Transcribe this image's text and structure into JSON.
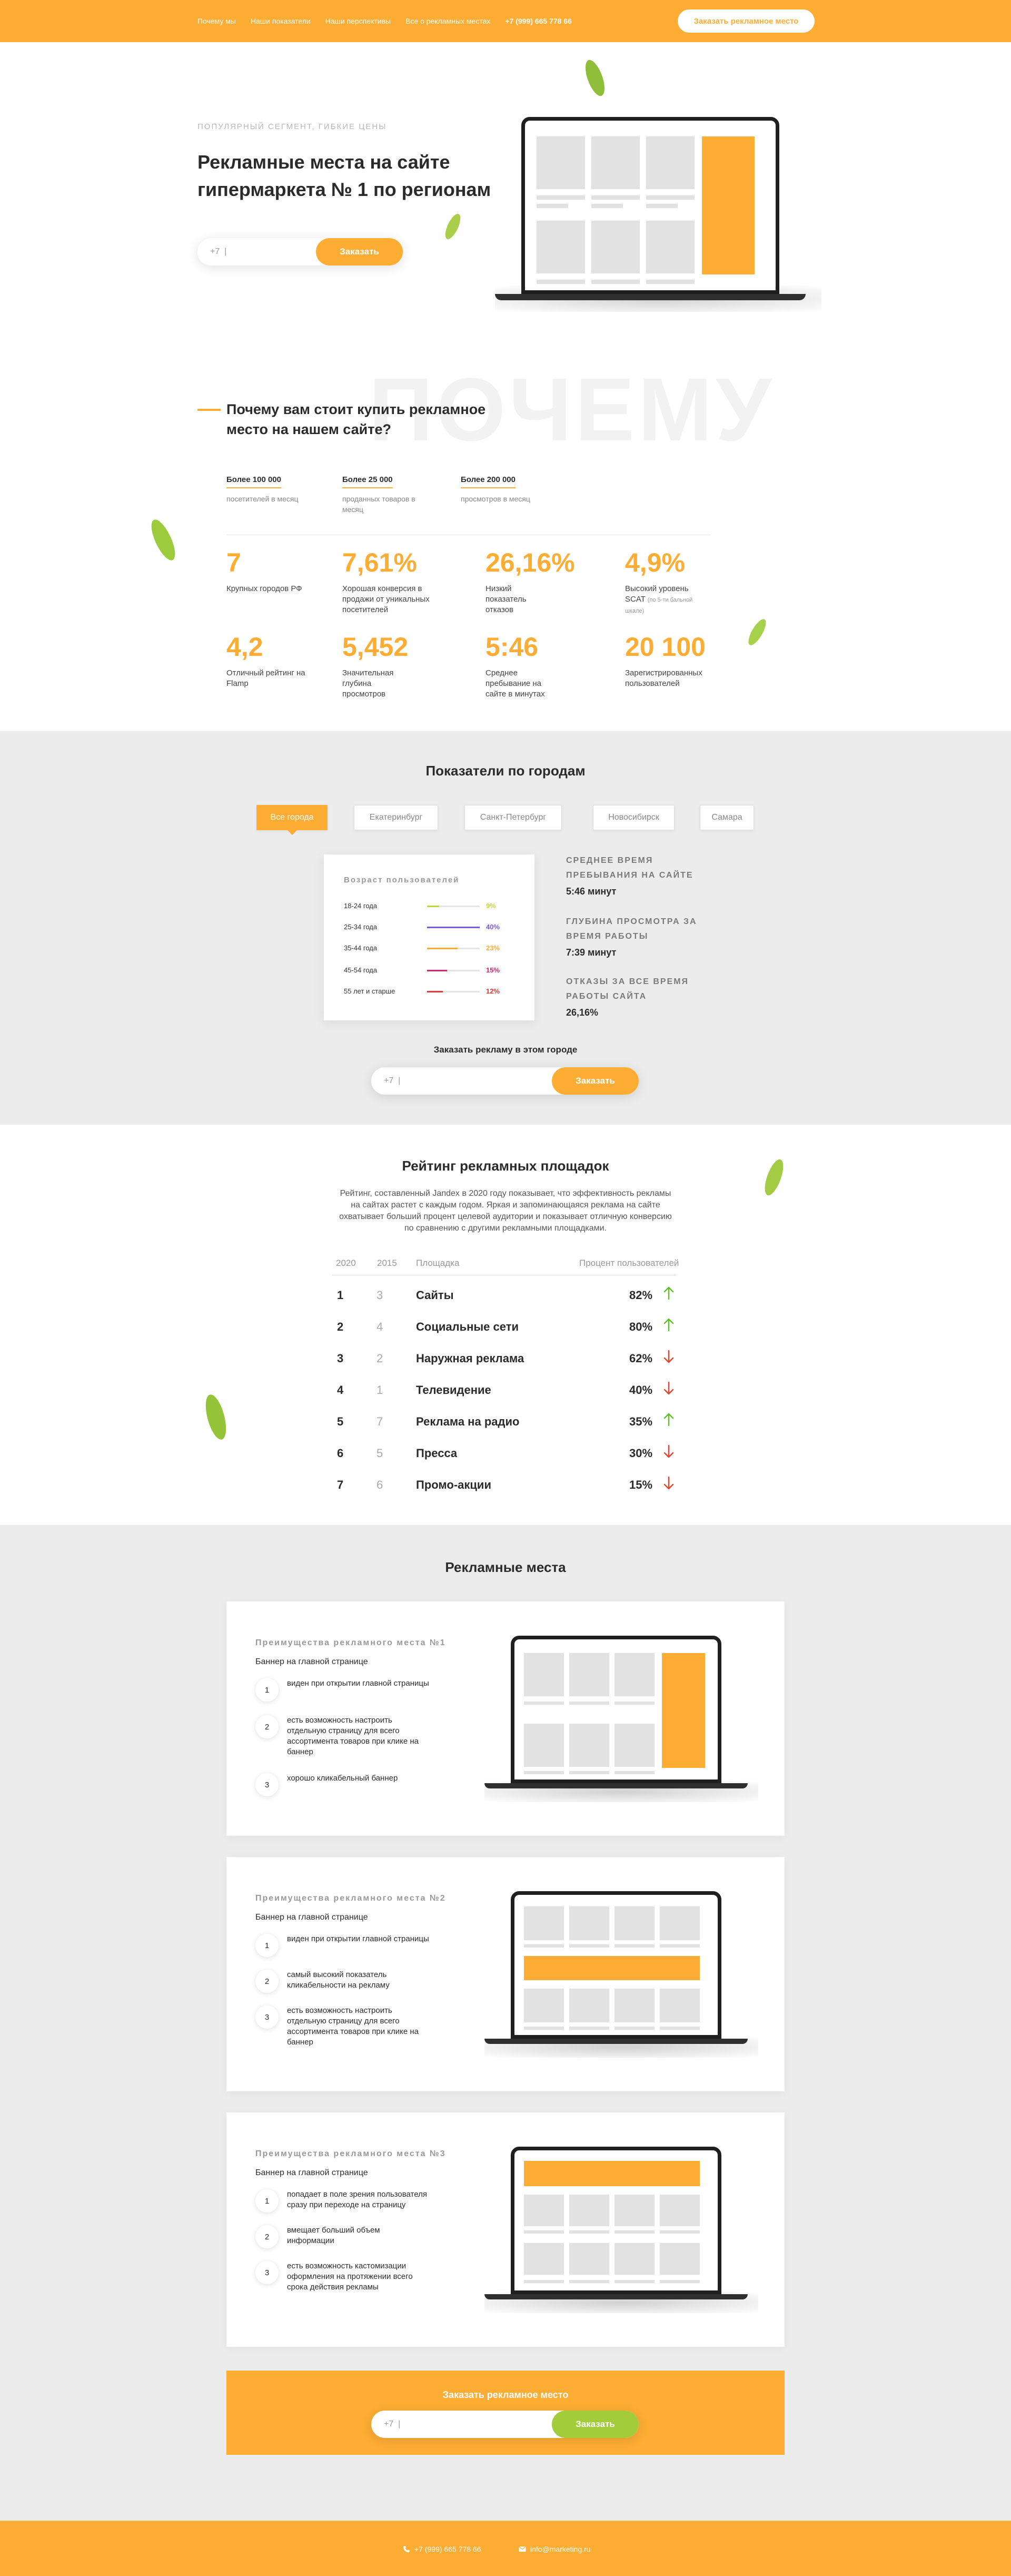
{
  "header": {
    "nav": [
      "Почему мы",
      "Наши показатели",
      "Наши перспективы",
      "Все о рекламных местах"
    ],
    "phone": "+7 (999) 665 778 66",
    "order_button": "Заказать рекламное место"
  },
  "hero": {
    "subtitle": "Популярный сегмент, гибкие цены",
    "title": "Рекламные места на сайте гипермаркета № 1 по регионам",
    "phone_prefix": "+7",
    "order_button": "Заказать"
  },
  "why": {
    "watermark": "ПОЧЕМУ",
    "title": "Почему вам стоит купить рекламное место на нашем сайте?",
    "small_stats": [
      {
        "value": "Более 100 000",
        "label": "посетителей в месяц"
      },
      {
        "value": "Более 25 000",
        "label": "проданных товаров в месяц"
      },
      {
        "value": "Более 200 000",
        "label": "просмотров в месяц"
      }
    ],
    "big_stats": [
      {
        "value": "7",
        "label": "Крупных городов РФ"
      },
      {
        "value": "7,61%",
        "label": "Хорошая конверсия в продажи от уникальных посетителей"
      },
      {
        "value": "26,16%",
        "label": "Низкий показатель отказов"
      },
      {
        "value": "4,9%",
        "label": "Высокий уровень SCAT",
        "note": "(по 5-ти бальной шкале)"
      },
      {
        "value": "4,2",
        "label": "Отличный рейтинг на Flamp"
      },
      {
        "value": "5,452",
        "label": "Значительная глубина просмотров"
      },
      {
        "value": "5:46",
        "label": "Среднее пребывание на сайте в минутах"
      },
      {
        "value": "20 100",
        "label": "Зарегистрированных пользователей"
      }
    ]
  },
  "cities": {
    "title": "Показатели по городам",
    "tabs": [
      "Все города",
      "Екатеринбург",
      "Санкт-Петербург",
      "Новосибирск",
      "Самара"
    ],
    "active_tab": "Все города",
    "age_card_title": "Возраст пользователей",
    "ages": [
      {
        "label": "18-24 года",
        "percent": 9,
        "display": "9%",
        "color": "#c6d63a"
      },
      {
        "label": "25-34 года",
        "percent": 40,
        "display": "40%",
        "color": "#7d5ae0"
      },
      {
        "label": "35-44 года",
        "percent": 23,
        "display": "23%",
        "color": "#fdad34"
      },
      {
        "label": "45-54 года",
        "percent": 15,
        "display": "15%",
        "color": "#d4237a"
      },
      {
        "label": "55 лет и старше",
        "percent": 12,
        "display": "12%",
        "color": "#e23a3a"
      }
    ],
    "metrics": [
      {
        "title": "Среднее время пребывания на сайте",
        "value": "5:46 минут"
      },
      {
        "title": "Глубина просмотра за время работы",
        "value": "7:39 минут"
      },
      {
        "title": "Отказы за все время работы сайта",
        "value": "26,16%"
      }
    ],
    "order_title": "Заказать рекламу в этом городе",
    "phone_prefix": "+7",
    "order_button": "Заказать"
  },
  "rating": {
    "title": "Рейтинг рекламных площадок",
    "description": "Рейтинг, составленный Jandex в 2020 году показывает, что эффективность рекламы на сайтах растет с каждым годом. Яркая и запоминающаяся реклама на сайте охватывает больший процент целевой аудитории и показывает отличную конверсию по сравнению с другими рекламными площадками.",
    "columns": [
      "2020",
      "2015",
      "Площадка",
      "Процент пользователей"
    ],
    "rows": [
      {
        "rank2020": "1",
        "rank2015": "3",
        "name": "Сайты",
        "percent": "82%",
        "trend": "up"
      },
      {
        "rank2020": "2",
        "rank2015": "4",
        "name": "Социальные сети",
        "percent": "80%",
        "trend": "up"
      },
      {
        "rank2020": "3",
        "rank2015": "2",
        "name": "Наружная реклама",
        "percent": "62%",
        "trend": "down"
      },
      {
        "rank2020": "4",
        "rank2015": "1",
        "name": "Телевидение",
        "percent": "40%",
        "trend": "down"
      },
      {
        "rank2020": "5",
        "rank2015": "7",
        "name": "Реклама на радио",
        "percent": "35%",
        "trend": "up"
      },
      {
        "rank2020": "6",
        "rank2015": "5",
        "name": "Пресса",
        "percent": "30%",
        "trend": "down"
      },
      {
        "rank2020": "7",
        "rank2015": "6",
        "name": "Промо-акции",
        "percent": "15%",
        "trend": "down"
      }
    ]
  },
  "places": {
    "title": "Рекламные места",
    "cards": [
      {
        "kicker": "Преимущества рекламного места №1",
        "subtitle": "Баннер на главной странице",
        "features": [
          "виден при открытии главной страницы",
          "есть возможность настроить отдельную страницу для всего ассортимента товаров при клике на баннер",
          "хорошо кликабельный баннер"
        ]
      },
      {
        "kicker": "Преимущества рекламного места №2",
        "subtitle": "Баннер на главной странице",
        "features": [
          "виден при открытии главной страницы",
          "самый высокий показатель кликабельности на рекламу",
          "есть возможность настроить отдельную страницу для всего ассортимента товаров при клике на баннер"
        ]
      },
      {
        "kicker": "Преимущества рекламного места №3",
        "subtitle": "Баннер на главной странице",
        "features": [
          "попадает в поле зрения пользователя сразу при переходе на страницу",
          "вмещает больший объем информации",
          "есть возможность кастомизации оформления на протяжении всего срока действия рекламы"
        ]
      }
    ],
    "cta_title": "Заказать рекламное место",
    "phone_prefix": "+7",
    "order_button": "Заказать"
  },
  "footer": {
    "phone": "+7 (999) 665 778 66",
    "email": "info@marketing.ru"
  },
  "colors": {
    "accent": "#fdad34",
    "green": "#a3cc3a",
    "arrow_up": "#5fbf2a",
    "arrow_down": "#e2442f"
  }
}
